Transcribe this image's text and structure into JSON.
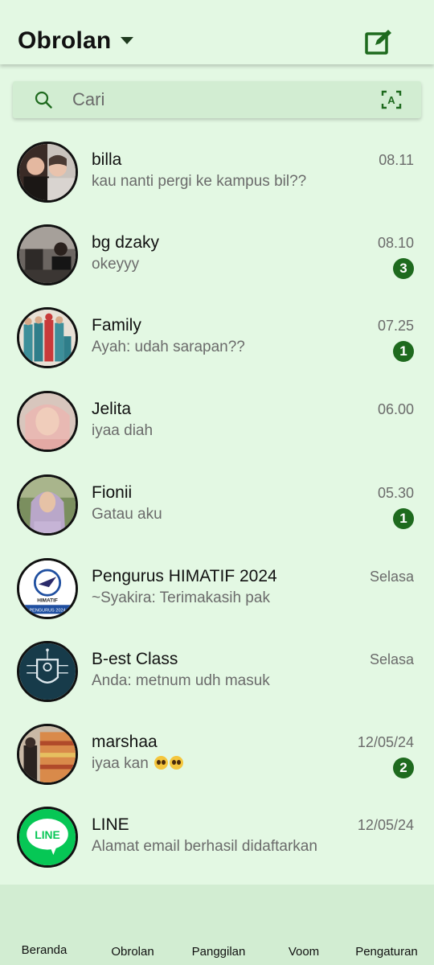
{
  "header": {
    "title": "Obrolan"
  },
  "search": {
    "placeholder": "Cari"
  },
  "chats": [
    {
      "name": "billa",
      "preview": "kau nanti pergi ke kampus bil??",
      "time": "08.11",
      "unread": ""
    },
    {
      "name": "bg dzaky",
      "preview": "okeyyy",
      "time": "08.10",
      "unread": "3"
    },
    {
      "name": "Family",
      "preview": "Ayah: udah sarapan??",
      "time": "07.25",
      "unread": "1"
    },
    {
      "name": "Jelita",
      "preview": "iyaa diah",
      "time": "06.00",
      "unread": ""
    },
    {
      "name": "Fionii",
      "preview": "Gatau aku",
      "time": "05.30",
      "unread": "1"
    },
    {
      "name": "Pengurus HIMATIF 2024",
      "preview": "~Syakira: Terimakasih pak",
      "time": "Selasa",
      "unread": "",
      "avatar_text": "HIMATIF",
      "avatar_subtext": "PENGURUS 2024"
    },
    {
      "name": "B-est Class",
      "preview": "Anda: metnum udh masuk",
      "time": "Selasa",
      "unread": ""
    },
    {
      "name": "marshaa",
      "preview": "iyaa kan",
      "preview_emoji": "pleading-face-emoji x2",
      "time": "12/05/24",
      "unread": "2"
    },
    {
      "name": "LINE",
      "preview": "Alamat email berhasil didaftarkan",
      "time": "12/05/24",
      "unread": "",
      "avatar_text": "LINE"
    }
  ],
  "nav": {
    "home": "Beranda",
    "chats": "Obrolan",
    "calls": "Panggilan",
    "voom": "Voom",
    "settings": "Pengaturan"
  },
  "colors": {
    "background": "#e3f8e3",
    "search_bar": "#d2edd2",
    "accent": "#1e6a1e",
    "line_green": "#06c755"
  },
  "icons": {
    "compose": "compose-icon",
    "search": "search-icon",
    "scan": "text-scan-icon",
    "dropdown": "chevron-down-icon"
  }
}
